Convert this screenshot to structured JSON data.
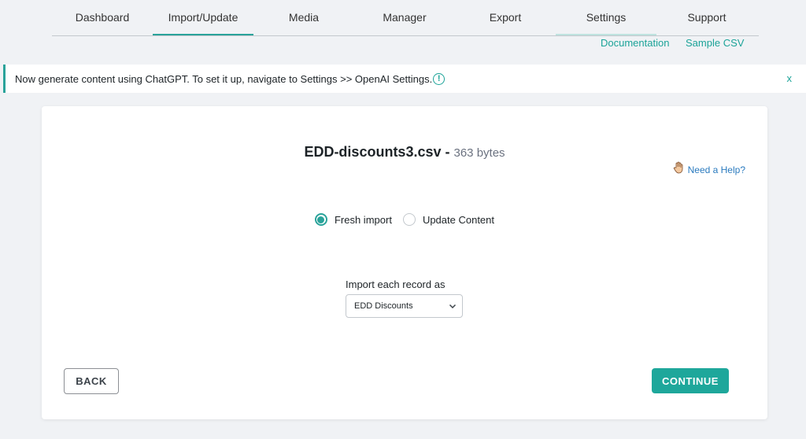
{
  "nav": {
    "tabs": [
      {
        "label": "Dashboard"
      },
      {
        "label": "Import/Update"
      },
      {
        "label": "Media"
      },
      {
        "label": "Manager"
      },
      {
        "label": "Export"
      },
      {
        "label": "Settings"
      },
      {
        "label": "Support"
      }
    ],
    "active_tab": "Import/Update",
    "sub_links": [
      {
        "label": "Documentation"
      },
      {
        "label": "Sample CSV"
      }
    ]
  },
  "notice": {
    "text": "Now generate content using ChatGPT. To set it up, navigate to Settings >> OpenAI Settings.",
    "info_icon": "!",
    "close_label": "x"
  },
  "card": {
    "file_name": "EDD-discounts3.csv",
    "separator": " - ",
    "file_size": "363 bytes",
    "help_label": "Need a Help?",
    "import_mode": {
      "options": [
        {
          "label": "Fresh import",
          "checked": true
        },
        {
          "label": "Update Content",
          "checked": false
        }
      ]
    },
    "import_as_label": "Import each record as",
    "import_as_value": "EDD Discounts",
    "back_label": "BACK",
    "continue_label": "CONTINUE"
  },
  "colors": {
    "accent": "#2aa39a",
    "button_primary": "#1ea79b",
    "link_blue": "#2b7bbf"
  }
}
